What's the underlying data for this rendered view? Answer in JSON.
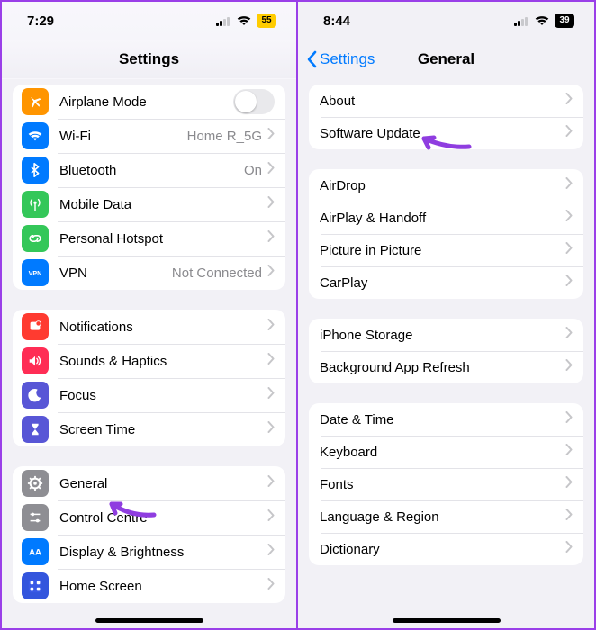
{
  "left": {
    "time": "7:29",
    "battery": "55",
    "title": "Settings",
    "groups": [
      [
        {
          "id": "airplane",
          "label": "Airplane Mode",
          "icon": "airplane",
          "color": "#ff9500",
          "control": "toggle"
        },
        {
          "id": "wifi",
          "label": "Wi-Fi",
          "icon": "wifi",
          "color": "#007aff",
          "value": "Home R_5G"
        },
        {
          "id": "bluetooth",
          "label": "Bluetooth",
          "icon": "bluetooth",
          "color": "#007aff",
          "value": "On"
        },
        {
          "id": "mobiledata",
          "label": "Mobile Data",
          "icon": "antenna",
          "color": "#34c759"
        },
        {
          "id": "hotspot",
          "label": "Personal Hotspot",
          "icon": "link",
          "color": "#34c759"
        },
        {
          "id": "vpn",
          "label": "VPN",
          "icon": "vpn",
          "color": "#007aff",
          "value": "Not Connected"
        }
      ],
      [
        {
          "id": "notifications",
          "label": "Notifications",
          "icon": "bell",
          "color": "#ff3b30"
        },
        {
          "id": "sounds",
          "label": "Sounds & Haptics",
          "icon": "speaker",
          "color": "#ff2d55"
        },
        {
          "id": "focus",
          "label": "Focus",
          "icon": "moon",
          "color": "#5856d6"
        },
        {
          "id": "screentime",
          "label": "Screen Time",
          "icon": "hourglass",
          "color": "#5856d6"
        }
      ],
      [
        {
          "id": "general",
          "label": "General",
          "icon": "gear",
          "color": "#8e8e93"
        },
        {
          "id": "controlcentre",
          "label": "Control Centre",
          "icon": "sliders",
          "color": "#8e8e93"
        },
        {
          "id": "display",
          "label": "Display & Brightness",
          "icon": "aa",
          "color": "#007aff"
        },
        {
          "id": "homescreen",
          "label": "Home Screen",
          "icon": "grid",
          "color": "#3355dd"
        }
      ]
    ]
  },
  "right": {
    "time": "8:44",
    "battery": "39",
    "back": "Settings",
    "title": "General",
    "groups": [
      [
        {
          "id": "about",
          "label": "About"
        },
        {
          "id": "softwareupdate",
          "label": "Software Update"
        }
      ],
      [
        {
          "id": "airdrop",
          "label": "AirDrop"
        },
        {
          "id": "airplay",
          "label": "AirPlay & Handoff"
        },
        {
          "id": "pip",
          "label": "Picture in Picture"
        },
        {
          "id": "carplay",
          "label": "CarPlay"
        }
      ],
      [
        {
          "id": "storage",
          "label": "iPhone Storage"
        },
        {
          "id": "refresh",
          "label": "Background App Refresh"
        }
      ],
      [
        {
          "id": "datetime",
          "label": "Date & Time"
        },
        {
          "id": "keyboard",
          "label": "Keyboard"
        },
        {
          "id": "fonts",
          "label": "Fonts"
        },
        {
          "id": "language",
          "label": "Language & Region"
        },
        {
          "id": "dictionary",
          "label": "Dictionary"
        }
      ]
    ]
  }
}
